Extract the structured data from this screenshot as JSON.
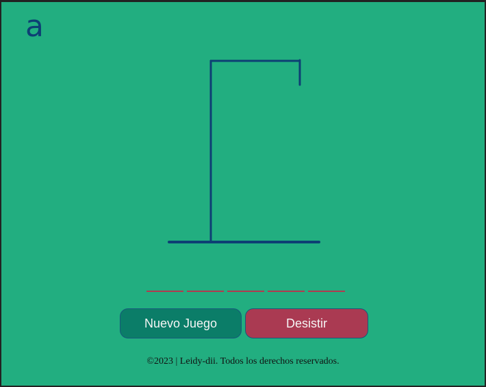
{
  "logo": {
    "text": "a"
  },
  "game": {
    "word_length": 5
  },
  "buttons": {
    "new_game": "Nuevo Juego",
    "give_up": "Desistir"
  },
  "footer": {
    "text": "©2023 | Leidy-dii. Todos los derechos reservados."
  },
  "colors": {
    "background": "#22ae80",
    "gallows": "#0d3f74",
    "slot": "#b23a4f",
    "new_game": "#0b7d68",
    "give_up": "#aa3a52"
  }
}
